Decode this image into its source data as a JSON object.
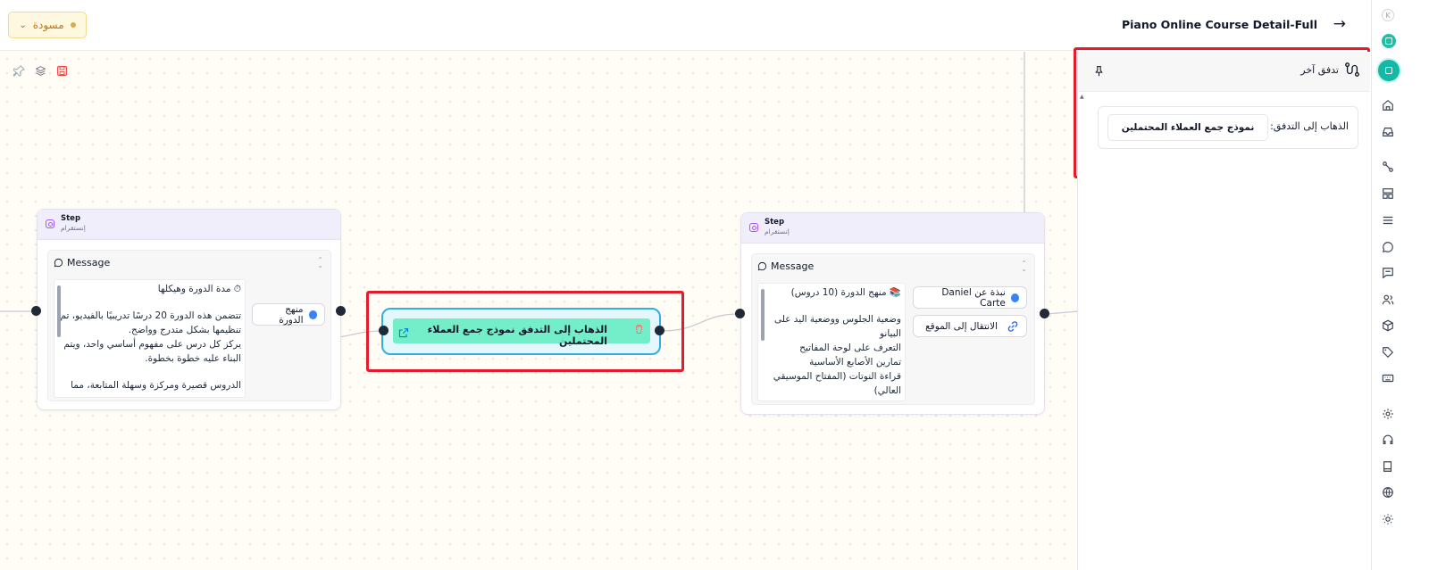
{
  "header": {
    "status_label": "مسودة",
    "page_title": "Piano Online Course Detail-Full"
  },
  "canvas": {
    "tools": [
      "pin-icon",
      "layers-icon",
      "save-icon"
    ]
  },
  "step_left": {
    "label": "Step",
    "sub": "إنستقرام",
    "message_title": "Message",
    "message_lines": [
      "⏱ مدة الدورة وهيكلها",
      "",
      "تتضمن هذه الدورة 20 درسًا تدريبيًا بالفيديو، تم تنظيمها بشكل متدرج وواضح.",
      "يركز كل درس على مفهوم أساسي واحد، ويتم البناء عليه خطوة بخطوة.",
      "",
      "الدروس قصيرة ومركزة وسهلة المتابعة، مما"
    ],
    "button_label": "منهج الدورة"
  },
  "goto_node": {
    "label": "الذهاب إلى التدفق نموذج جمع العملاء المحتملين"
  },
  "step_right": {
    "label": "Step",
    "sub": "إنستقرام",
    "message_title": "Message",
    "message_lines": [
      "📚 منهج الدورة (10 دروس)",
      "",
      "وضعية الجلوس ووضعية اليد على البيانو",
      "التعرف على لوحة المفاتيح",
      "تمارين الأصابع الأساسية",
      "قراءة النوتات (المفتاح الموسيقي العالي)"
    ],
    "button_about": "نبذة عن Daniel Carte",
    "button_site": "الانتقال إلى الموقع"
  },
  "panel": {
    "title": "تدفق آخر",
    "field_label": "الذهاب إلى التدفق:",
    "field_value": "نموذج جمع العملاء المحتملين"
  },
  "rail": {
    "avatar_letter": "K",
    "icons": [
      "home-icon",
      "inbox-icon",
      "flows-icon",
      "layout-icon",
      "list-icon",
      "chat-icon",
      "comments-icon",
      "contacts-icon",
      "package-icon",
      "tag-icon",
      "keyboard-icon",
      "settings-icon",
      "headset-icon",
      "book-icon",
      "globe-icon",
      "sun-icon"
    ]
  },
  "colors": {
    "accent_teal": "#14b8a6",
    "highlight_red": "#e31b2d",
    "goto_fill": "#73eec9",
    "goto_border": "#34aee0",
    "draft_orange": "#e0a84a"
  }
}
